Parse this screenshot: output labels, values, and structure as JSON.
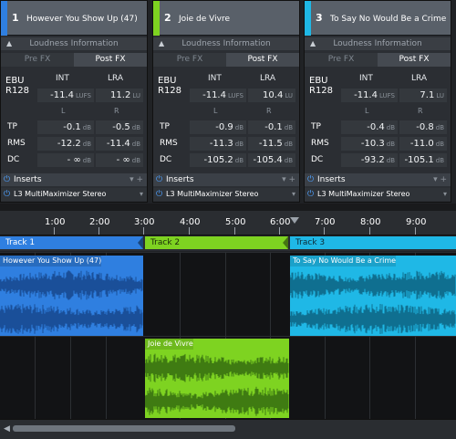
{
  "strips": [
    {
      "num": "1",
      "name": "However You Show Up (47)",
      "color": "#2f7fe0",
      "loudness_label": "Loudness Information",
      "tabs": [
        "Pre FX",
        "Post FX"
      ],
      "int_label": "INT",
      "lra_label": "LRA",
      "ebu_label": "EBU",
      "r128_label": "R128",
      "l_label": "L",
      "r_label": "R",
      "int_value": "-11.4",
      "int_unit": "LUFS",
      "lra_value": "11.2",
      "lra_unit": "LU",
      "tp_l": "-0.1",
      "tp_r": "-0.5",
      "rms_l": "-12.2",
      "rms_r": "-11.4",
      "dc_l": "- ∞",
      "dc_r": "- ∞",
      "unit_db": "dB",
      "inserts_label": "Inserts",
      "plugin": "L3 MultiMaximizer Stereo"
    },
    {
      "num": "2",
      "name": "Joie de Vivre",
      "color": "#7ed321",
      "loudness_label": "Loudness Information",
      "tabs": [
        "Pre FX",
        "Post FX"
      ],
      "int_label": "INT",
      "lra_label": "LRA",
      "ebu_label": "EBU",
      "r128_label": "R128",
      "l_label": "L",
      "r_label": "R",
      "int_value": "-11.4",
      "int_unit": "LUFS",
      "lra_value": "10.4",
      "lra_unit": "LU",
      "tp_l": "-0.9",
      "tp_r": "-0.1",
      "rms_l": "-11.3",
      "rms_r": "-11.5",
      "dc_l": "-105.2",
      "dc_r": "-105.4",
      "unit_db": "dB",
      "inserts_label": "Inserts",
      "plugin": "L3 MultiMaximizer Stereo"
    },
    {
      "num": "3",
      "name": "To Say No Would Be a Crime",
      "color": "#1fb8e6",
      "loudness_label": "Loudness Information",
      "tabs": [
        "Pre FX",
        "Post FX"
      ],
      "int_label": "INT",
      "lra_label": "LRA",
      "ebu_label": "EBU",
      "r128_label": "R128",
      "l_label": "L",
      "r_label": "R",
      "int_value": "-11.4",
      "int_unit": "LUFS",
      "lra_value": "7.1",
      "lra_unit": "LU",
      "tp_l": "-0.4",
      "tp_r": "-0.8",
      "rms_l": "-10.3",
      "rms_r": "-11.0",
      "dc_l": "-93.2",
      "dc_r": "-105.1",
      "unit_db": "dB",
      "inserts_label": "Inserts",
      "plugin": "L3 MultiMaximizer Stereo"
    }
  ],
  "row_labels": {
    "tp": "TP",
    "rms": "RMS",
    "dc": "DC"
  },
  "insert_controls": "▾ +",
  "timeline": {
    "ruler_labels": [
      "1:00",
      "2:00",
      "3:00",
      "4:00",
      "5:00",
      "6:00",
      "7:00",
      "8:00",
      "9:00"
    ],
    "tracks": [
      {
        "label": "Track 1",
        "color": "#2f7fe0",
        "text_color": "#ffffff"
      },
      {
        "label": "Track 2",
        "color": "#7ed321",
        "text_color": "#1b2a0a"
      },
      {
        "label": "Track 3",
        "color": "#1fb8e6",
        "text_color": "#0c2a36"
      }
    ],
    "clips": [
      {
        "title": "However You Show Up (47)",
        "color": "#2f7fe0",
        "wave": "#1a4f99"
      },
      {
        "title": "Joie de Vivre",
        "color": "#7ed321",
        "wave": "#3f7b12"
      },
      {
        "title": "To Say No Would Be a Crime",
        "color": "#1fb8e6",
        "wave": "#0f6f90"
      }
    ]
  }
}
